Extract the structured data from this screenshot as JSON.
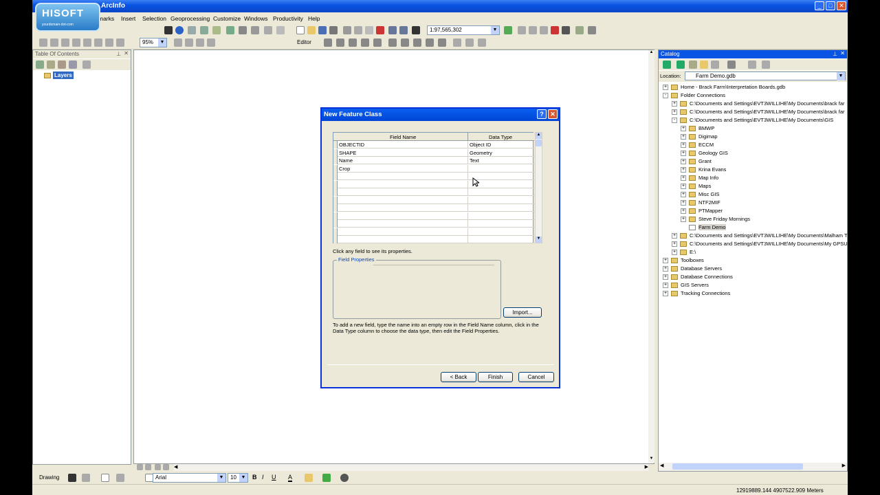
{
  "window": {
    "title": "ArcInfo",
    "logo_main": "HISOFT",
    "logo_sub": "yourdomain-dot-com"
  },
  "menu": [
    "marks",
    "Insert",
    "Selection",
    "Geoprocessing",
    "Customize",
    "Windows",
    "Productivity",
    "Help"
  ],
  "toolbar": {
    "scale_value": "1:97,565,302",
    "zoom_value": "95%",
    "editor_label": "Editor"
  },
  "toc": {
    "title": "Table Of Contents",
    "layers_label": "Layers"
  },
  "catalog": {
    "title": "Catalog",
    "location_label": "Location:",
    "location_value": "Farm Demo.gdb",
    "tree": [
      {
        "label": "Home - Brack Farm\\Interpretation Boards.gdb",
        "level": 0,
        "exp": "+"
      },
      {
        "label": "Folder Connections",
        "level": 0,
        "exp": "-"
      },
      {
        "label": "C:\\Documents and Settings\\EVT3WILLIHE\\My Documents\\brack far",
        "level": 1,
        "exp": "+"
      },
      {
        "label": "C:\\Documents and Settings\\EVT3WILLIHE\\My Documents\\brack far",
        "level": 1,
        "exp": "+"
      },
      {
        "label": "C:\\Documents and Settings\\EVT3WILLIHE\\My Documents\\GIS",
        "level": 1,
        "exp": "-"
      },
      {
        "label": "BMWP",
        "level": 2,
        "exp": "+"
      },
      {
        "label": "Digimap",
        "level": 2,
        "exp": "+"
      },
      {
        "label": "ECCM",
        "level": 2,
        "exp": "+"
      },
      {
        "label": "Geology GIS",
        "level": 2,
        "exp": "+"
      },
      {
        "label": "Grant",
        "level": 2,
        "exp": "+"
      },
      {
        "label": "Krina Evans",
        "level": 2,
        "exp": "+"
      },
      {
        "label": "Map Info",
        "level": 2,
        "exp": "+"
      },
      {
        "label": "Maps",
        "level": 2,
        "exp": "+"
      },
      {
        "label": "Misc GIS",
        "level": 2,
        "exp": "+"
      },
      {
        "label": "NTF2MIF",
        "level": 2,
        "exp": "+"
      },
      {
        "label": "PTMapper",
        "level": 2,
        "exp": "+"
      },
      {
        "label": "Steve Friday Mornings",
        "level": 2,
        "exp": "+"
      },
      {
        "label": "Farm Demo",
        "level": 2,
        "exp": ""
      },
      {
        "label": "C:\\Documents and Settings\\EVT3WILLIHE\\My Documents\\Malham T",
        "level": 1,
        "exp": "+"
      },
      {
        "label": "C:\\Documents and Settings\\EVT3WILLIHE\\My Documents\\My GPSU",
        "level": 1,
        "exp": "+"
      },
      {
        "label": "E:\\",
        "level": 1,
        "exp": "+"
      },
      {
        "label": "Toolboxes",
        "level": 0,
        "exp": "+"
      },
      {
        "label": "Database Servers",
        "level": 0,
        "exp": "+"
      },
      {
        "label": "Database Connections",
        "level": 0,
        "exp": "+"
      },
      {
        "label": "GIS Servers",
        "level": 0,
        "exp": "+"
      },
      {
        "label": "Tracking Connections",
        "level": 0,
        "exp": "+"
      }
    ]
  },
  "dialog": {
    "title": "New Feature Class",
    "col_field_name": "Field Name",
    "col_data_type": "Data Type",
    "rows": [
      {
        "name": "OBJECTID",
        "type": "Object ID"
      },
      {
        "name": "SHAPE",
        "type": "Geometry"
      },
      {
        "name": "Name",
        "type": "Text"
      },
      {
        "name": "Crop",
        "type": ""
      },
      {
        "name": "",
        "type": ""
      },
      {
        "name": "",
        "type": ""
      },
      {
        "name": "",
        "type": ""
      },
      {
        "name": "",
        "type": ""
      },
      {
        "name": "",
        "type": ""
      },
      {
        "name": "",
        "type": ""
      },
      {
        "name": "",
        "type": ""
      },
      {
        "name": "",
        "type": ""
      },
      {
        "name": "",
        "type": ""
      }
    ],
    "hint": "Click any field to see its properties.",
    "field_properties_label": "Field Properties",
    "import_label": "Import...",
    "instructions": "To add a new field, type the name into an empty row in the Field Name column, click in the Data Type column to choose the data type, then edit the Field Properties.",
    "back_label": "< Back",
    "finish_label": "Finish",
    "cancel_label": "Cancel"
  },
  "drawing": {
    "drawing_label": "Drawing",
    "font_name": "Arial",
    "font_size": "10"
  },
  "status": {
    "coordinates": "12919889.144  4907522.909 Meters"
  }
}
